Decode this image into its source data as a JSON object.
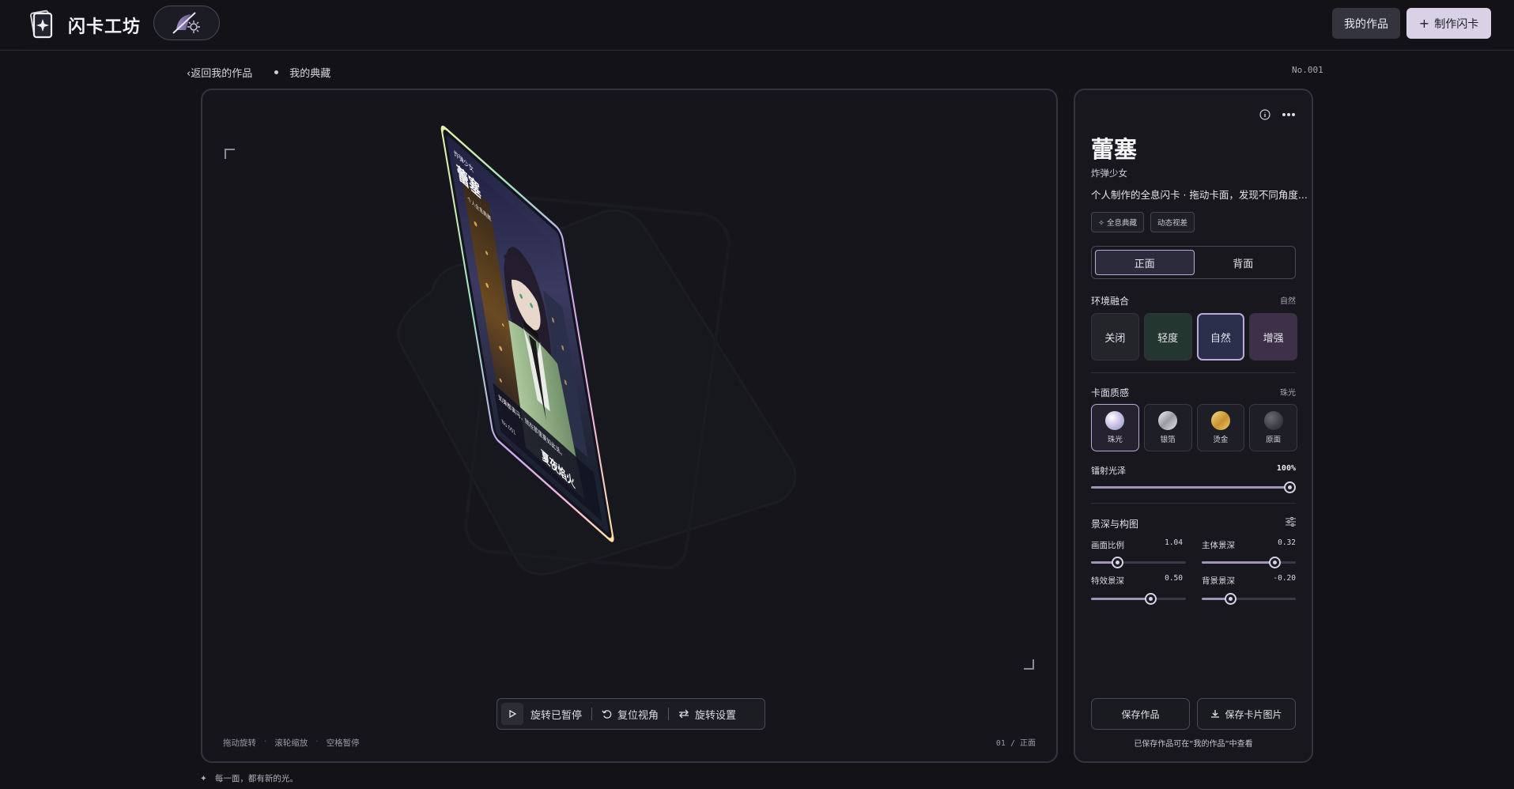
{
  "app": {
    "title": "闪卡工坊",
    "logo_icon": "sparkle-card-icon",
    "mode_icon": "hologram-toggle-icon"
  },
  "header": {
    "my_works_label": "我的作品",
    "create_label": "制作闪卡",
    "create_icon": "plus-icon"
  },
  "breadcrumb": {
    "back_label": "返回我的作品",
    "current_label": "我的典藏"
  },
  "serial": "No.001",
  "card": {
    "series": "炸弹少女",
    "name": "蕾塞",
    "maker": "个人全息典藏",
    "quote": "如果都离马，就在那里夏如此话。",
    "footer_title": "夏夜焰火",
    "number": "No.001"
  },
  "stage": {
    "controls": {
      "rotate_label": "旋转已暂停",
      "reset_label": "复位视角",
      "settings_label": "旋转设置"
    },
    "hints": [
      "拖动旋转",
      "滚轮缩放",
      "空格暂停"
    ],
    "face_indicator": "01 / 正面",
    "tagline": "每一面，都有新的光。"
  },
  "panel": {
    "name": "蕾塞",
    "subtitle": "炸弹少女",
    "description": "个人制作的全息闪卡 · 拖动卡面，发现不同角度...",
    "tags": [
      "✧ 全息典藏",
      "动态视差"
    ],
    "face_tabs": [
      {
        "label": "正面",
        "active": true
      },
      {
        "label": "背面",
        "active": false
      }
    ],
    "env": {
      "title": "环境融合",
      "value": "自然",
      "options": [
        {
          "label": "关闭",
          "bg": "#24242b",
          "active": false
        },
        {
          "label": "轻度",
          "bg": "#243630",
          "active": false
        },
        {
          "label": "自然",
          "bg": "#2c2f4c",
          "active": true
        },
        {
          "label": "增强",
          "bg": "#3e3048",
          "active": false
        }
      ]
    },
    "texture": {
      "title": "卡面质感",
      "value": "珠光",
      "options": [
        {
          "label": "珠光",
          "swatch": "radial-gradient(circle at 35% 35%,#ffffff,#cfc3e8 45%,#9fa9c7 80%)",
          "active": true
        },
        {
          "label": "银箔",
          "swatch": "linear-gradient(135deg,#f4f4f8,#9a9aa4 50%,#e6e6ee)",
          "active": false
        },
        {
          "label": "烫金",
          "swatch": "linear-gradient(135deg,#f6dc8a,#c8902e 55%,#f1cf6e)",
          "active": false
        },
        {
          "label": "原面",
          "swatch": "radial-gradient(circle at 35% 35%,#6a6a74,#36363e 70%)",
          "active": false
        }
      ]
    },
    "gloss": {
      "title": "镭射光泽",
      "value_label": "100%",
      "value": 1.0
    },
    "depth": {
      "title": "景深与构图",
      "sliders": [
        {
          "label": "画面比例",
          "value_label": "1.04",
          "fraction": 0.25
        },
        {
          "label": "主体景深",
          "value_label": "0.32",
          "fraction": 0.82
        },
        {
          "label": "特效景深",
          "value_label": "0.50",
          "fraction": 0.65
        },
        {
          "label": "背景景深",
          "value_label": "-0.20",
          "fraction": 0.28
        }
      ]
    },
    "save_label": "保存作品",
    "download_label": "保存卡片图片",
    "save_note": "已保存作品可在“我的作品”中查看"
  },
  "colors": {
    "accent": "#d9d2e6",
    "accent_border": "#b9a9d8",
    "bg": "#121217"
  }
}
